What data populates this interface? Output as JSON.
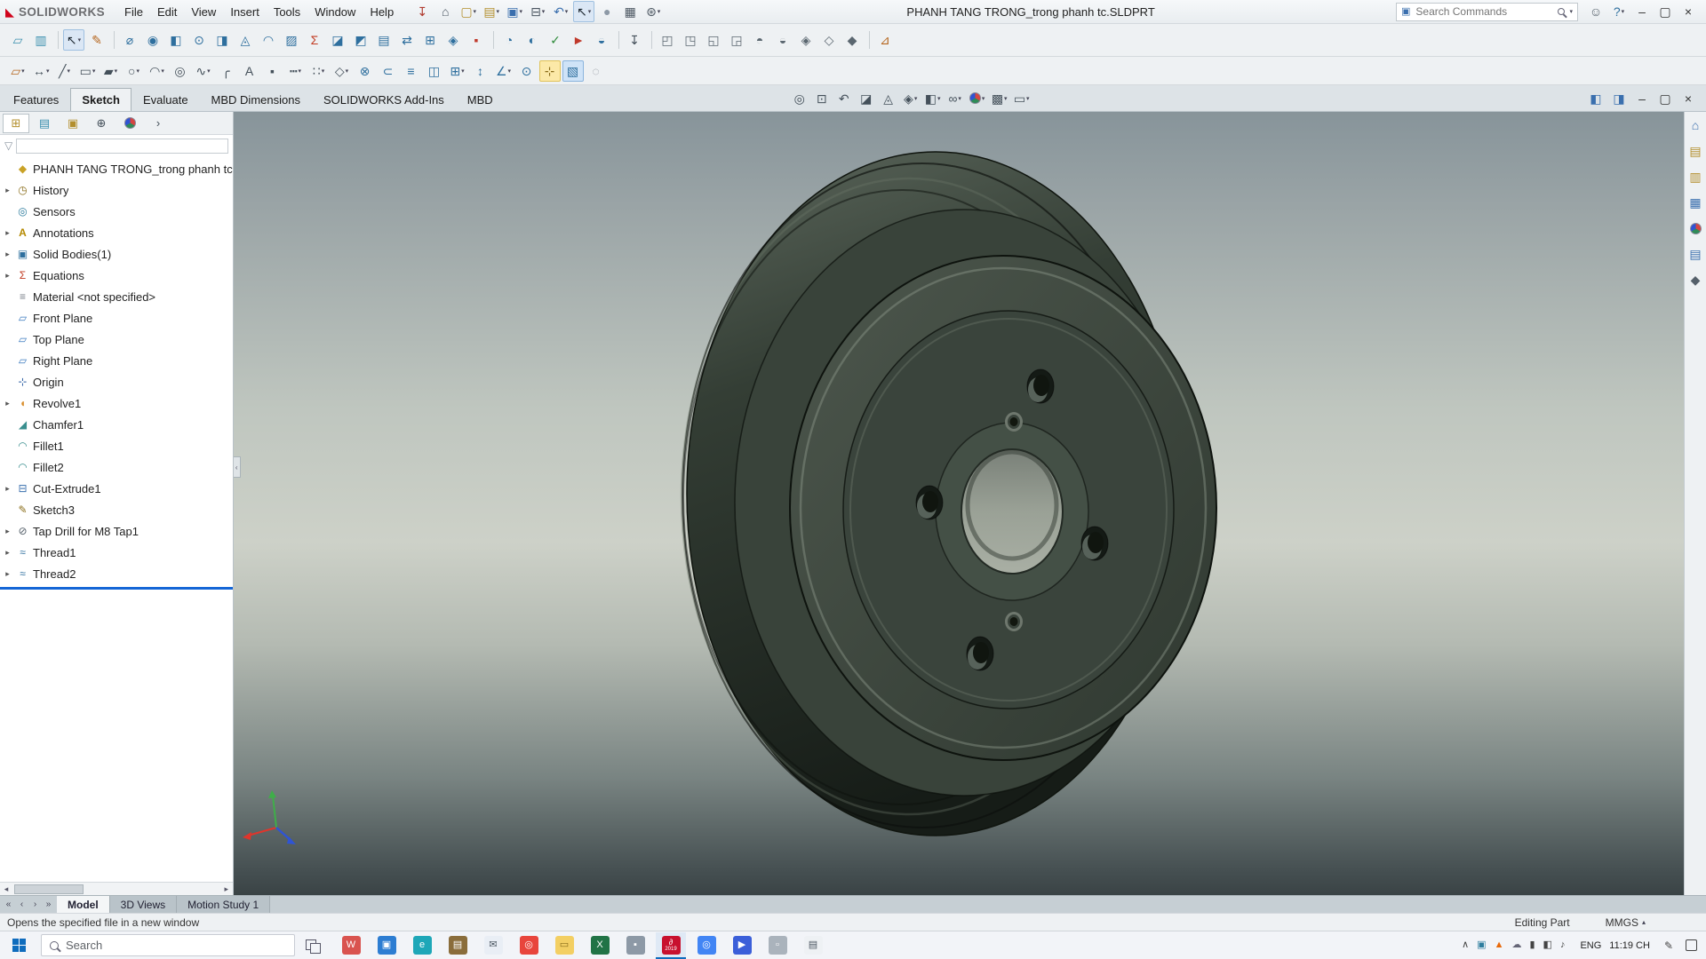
{
  "window": {
    "brand": "SOLIDWORKS",
    "title": "PHANH TANG TRONG_trong phanh tc.SLDPRT",
    "search_placeholder": "Search Commands",
    "menus": [
      "File",
      "Edit",
      "View",
      "Insert",
      "Tools",
      "Window",
      "Help"
    ],
    "quick_icons": [
      {
        "name": "pin-icon",
        "glyph": "↧",
        "color": "#b03a2e"
      },
      {
        "name": "home-icon",
        "glyph": "⌂",
        "color": "#4a5560"
      },
      {
        "name": "new-document-icon",
        "glyph": "▢",
        "color": "#b38f2d",
        "caret": true
      },
      {
        "name": "open-icon",
        "glyph": "▤",
        "color": "#b38f2d",
        "caret": true
      },
      {
        "name": "save-icon",
        "glyph": "▣",
        "color": "#3a6fae",
        "caret": true
      },
      {
        "name": "print-icon",
        "glyph": "⊟",
        "color": "#4a5560",
        "caret": true
      },
      {
        "name": "undo-icon",
        "glyph": "↶",
        "color": "#3a6fae",
        "caret": true
      },
      {
        "name": "select-cursor-icon",
        "glyph": "↖",
        "color": "#1f2a33",
        "caret": true,
        "pressed": true
      },
      {
        "name": "sphere-icon",
        "glyph": "●",
        "color": "#8d99a6"
      },
      {
        "name": "grid-options-icon",
        "glyph": "▦",
        "color": "#4a5560"
      },
      {
        "name": "options-gear-icon",
        "glyph": "⊛",
        "color": "#4a5560",
        "caret": true
      }
    ],
    "window_controls": [
      {
        "name": "user-account-icon",
        "glyph": "☺",
        "color": "#55606a"
      },
      {
        "name": "help-icon",
        "glyph": "?",
        "color": "#2e6f9e",
        "caret": true
      },
      {
        "name": "window-minimize-icon",
        "glyph": "–",
        "color": "#333333"
      },
      {
        "name": "window-restore-icon",
        "glyph": "▢",
        "color": "#333333"
      },
      {
        "name": "window-close-icon",
        "glyph": "×",
        "color": "#333333"
      }
    ]
  },
  "toolbar_row1": [
    {
      "name": "sheet-format-icon",
      "glyph": "▱",
      "color": "#3a8fae"
    },
    {
      "name": "design-table-icon",
      "glyph": "▥",
      "color": "#3a8fae"
    },
    {
      "sep": true
    },
    {
      "name": "select-tool-icon",
      "glyph": "↖",
      "color": "#1f2a33",
      "caret": true,
      "pressed": true
    },
    {
      "name": "sketch-pencil-icon",
      "glyph": "✎",
      "color": "#b5651d"
    },
    {
      "sep": true
    },
    {
      "name": "measure-icon",
      "glyph": "⌀",
      "color": "#2e6f9e"
    },
    {
      "name": "mass-properties-icon",
      "glyph": "◉",
      "color": "#2e6f9e"
    },
    {
      "name": "section-properties-icon",
      "glyph": "◧",
      "color": "#2e6f9e"
    },
    {
      "name": "sensor-icon",
      "glyph": "⊙",
      "color": "#2e6f9e"
    },
    {
      "name": "check-entity-icon",
      "glyph": "◨",
      "color": "#2e6f9e"
    },
    {
      "name": "geometry-analysis-icon",
      "glyph": "◬",
      "color": "#2e6f9e"
    },
    {
      "name": "curvature-icon",
      "glyph": "◠",
      "color": "#2e6f9e"
    },
    {
      "name": "zebra-stripes-icon",
      "glyph": "▨",
      "color": "#2e6f9e"
    },
    {
      "name": "equations-sigma-icon",
      "glyph": "Σ",
      "color": "#c23b22"
    },
    {
      "name": "draft-analysis-icon",
      "glyph": "◪",
      "color": "#2e6f9e"
    },
    {
      "name": "undercut-analysis-icon",
      "glyph": "◩",
      "color": "#2e6f9e"
    },
    {
      "name": "thickness-analysis-icon",
      "glyph": "▤",
      "color": "#2e6f9e"
    },
    {
      "name": "compare-documents-icon",
      "glyph": "⇄",
      "color": "#2e6f9e"
    },
    {
      "name": "symmetry-check-icon",
      "glyph": "⊞",
      "color": "#2e6f9e"
    },
    {
      "name": "deviation-analysis-icon",
      "glyph": "◈",
      "color": "#2e6f9e"
    },
    {
      "name": "stop-icon",
      "glyph": "▪",
      "color": "#c0392b"
    },
    {
      "sep": true
    },
    {
      "name": "performance-evaluation-icon",
      "glyph": "◔",
      "color": "#2e6f9e"
    },
    {
      "name": "import-diagnostics-icon",
      "glyph": "◐",
      "color": "#2e6f9e"
    },
    {
      "name": "geometry-check-icon",
      "glyph": "✓",
      "color": "#2e8b3a"
    },
    {
      "name": "error-flag-icon",
      "glyph": "►",
      "color": "#c0392b"
    },
    {
      "name": "design-checker-icon",
      "glyph": "◒",
      "color": "#2e6f9e"
    },
    {
      "sep": true
    },
    {
      "name": "mate-anchor-icon",
      "glyph": "↧",
      "color": "#44505a"
    },
    {
      "sep": true
    },
    {
      "name": "view-front-icon",
      "glyph": "◰",
      "color": "#5b6770"
    },
    {
      "name": "view-back-icon",
      "glyph": "◳",
      "color": "#5b6770"
    },
    {
      "name": "view-left-icon",
      "glyph": "◱",
      "color": "#5b6770"
    },
    {
      "name": "view-right-icon",
      "glyph": "◲",
      "color": "#5b6770"
    },
    {
      "name": "view-top-icon",
      "glyph": "◓",
      "color": "#5b6770"
    },
    {
      "name": "view-bottom-icon",
      "glyph": "◒",
      "color": "#5b6770"
    },
    {
      "name": "view-isometric-icon",
      "glyph": "◈",
      "color": "#5b6770"
    },
    {
      "name": "view-dimetric-icon",
      "glyph": "◇",
      "color": "#5b6770"
    },
    {
      "name": "view-trimetric-icon",
      "glyph": "◆",
      "color": "#5b6770"
    },
    {
      "sep": true
    },
    {
      "name": "tape-measure-icon",
      "glyph": "⊿",
      "color": "#b5651d"
    }
  ],
  "toolbar_row2": [
    {
      "name": "sketch-icon",
      "glyph": "▱",
      "color": "#b5651d",
      "caret": true
    },
    {
      "name": "smart-dimension-icon",
      "glyph": "↔",
      "color": "#44505a",
      "caret": true
    },
    {
      "name": "line-icon",
      "glyph": "╱",
      "color": "#44505a",
      "caret": true
    },
    {
      "name": "rectangle-icon",
      "glyph": "▭",
      "color": "#44505a",
      "caret": true
    },
    {
      "name": "slot-icon",
      "glyph": "▰",
      "color": "#44505a",
      "caret": true
    },
    {
      "name": "circle-icon",
      "glyph": "○",
      "color": "#44505a",
      "caret": true
    },
    {
      "name": "arc-icon",
      "glyph": "◠",
      "color": "#44505a",
      "caret": true
    },
    {
      "name": "ellipse-icon",
      "glyph": "◎",
      "color": "#44505a"
    },
    {
      "name": "spline-icon",
      "glyph": "∿",
      "color": "#44505a",
      "caret": true
    },
    {
      "name": "conic-icon",
      "glyph": "╭",
      "color": "#44505a"
    },
    {
      "name": "text-icon",
      "glyph": "A",
      "color": "#44505a"
    },
    {
      "name": "point-icon",
      "glyph": "▪",
      "color": "#44505a"
    },
    {
      "name": "centerline-icon",
      "glyph": "┅",
      "color": "#44505a",
      "caret": true
    },
    {
      "name": "pattern-icon",
      "glyph": "∷",
      "color": "#44505a",
      "caret": true
    },
    {
      "name": "polygon-icon",
      "glyph": "◇",
      "color": "#44505a",
      "caret": true
    },
    {
      "name": "trim-entities-icon",
      "glyph": "⊗",
      "color": "#2e6f9e"
    },
    {
      "name": "convert-entities-icon",
      "glyph": "⊂",
      "color": "#2e6f9e"
    },
    {
      "name": "offset-entities-icon",
      "glyph": "≡",
      "color": "#2e6f9e"
    },
    {
      "name": "mirror-entities-icon",
      "glyph": "◫",
      "color": "#2e6f9e"
    },
    {
      "name": "linear-sketch-pattern-icon",
      "glyph": "⊞",
      "color": "#2e6f9e",
      "caret": true
    },
    {
      "name": "move-entities-icon",
      "glyph": "↕",
      "color": "#2e6f9e"
    },
    {
      "name": "display-relations-icon",
      "glyph": "∠",
      "color": "#2e6f9e",
      "caret": true
    },
    {
      "name": "repair-sketch-icon",
      "glyph": "⊙",
      "color": "#2e6f9e"
    },
    {
      "name": "quick-snaps-icon",
      "glyph": "⊹",
      "color": "#8a6d1a",
      "hl": "yellow"
    },
    {
      "name": "sketch-picture-icon",
      "glyph": "▧",
      "color": "#2e6f9e",
      "hl": "blue"
    },
    {
      "name": "sketch-settings-icon",
      "glyph": "◌",
      "color": "#8a8f98"
    }
  ],
  "command_tabs": [
    {
      "label": "Features"
    },
    {
      "label": "Sketch",
      "active": true
    },
    {
      "label": "Evaluate"
    },
    {
      "label": "MBD Dimensions"
    },
    {
      "label": "SOLIDWORKS Add-Ins"
    },
    {
      "label": "MBD"
    }
  ],
  "headsup_icons": [
    {
      "name": "zoom-fit-icon",
      "glyph": "◎",
      "color": "#44505a"
    },
    {
      "name": "zoom-area-icon",
      "glyph": "⊡",
      "color": "#44505a"
    },
    {
      "name": "previous-view-icon",
      "glyph": "↶",
      "color": "#44505a"
    },
    {
      "name": "section-view-icon",
      "glyph": "◪",
      "color": "#44505a"
    },
    {
      "name": "dynamic-annotation-icon",
      "glyph": "◬",
      "color": "#44505a"
    },
    {
      "name": "view-orientation-icon",
      "glyph": "◈",
      "color": "#44505a",
      "caret": true
    },
    {
      "name": "display-style-icon",
      "glyph": "◧",
      "color": "#44505a",
      "caret": true
    },
    {
      "name": "hide-show-items-icon",
      "glyph": "∞",
      "color": "#44505a",
      "caret": true
    },
    {
      "name": "edit-appearance-icon",
      "ball": true,
      "caret": true
    },
    {
      "name": "apply-scene-icon",
      "glyph": "▩",
      "color": "#44505a",
      "caret": true
    },
    {
      "name": "view-settings-icon",
      "glyph": "▭",
      "color": "#44505a",
      "caret": true
    }
  ],
  "doc_window_controls": [
    {
      "name": "featuremanager-pane-icon",
      "glyph": "◧",
      "color": "#3a6fae"
    },
    {
      "name": "display-pane-icon",
      "glyph": "◨",
      "color": "#3a6fae"
    },
    {
      "name": "doc-minimize-icon",
      "glyph": "–",
      "color": "#333333"
    },
    {
      "name": "doc-restore-icon",
      "glyph": "▢",
      "color": "#333333"
    },
    {
      "name": "doc-close-icon",
      "glyph": "×",
      "color": "#333333"
    }
  ],
  "feature_panel": {
    "tabs": [
      {
        "name": "featuremanager-tab-icon",
        "glyph": "⊞",
        "color": "#b38f2d",
        "active": true
      },
      {
        "name": "propertymanager-tab-icon",
        "glyph": "▤",
        "color": "#3a8fae"
      },
      {
        "name": "configurationmanager-tab-icon",
        "glyph": "▣",
        "color": "#b38f2d"
      },
      {
        "name": "dimxpertmanager-tab-icon",
        "glyph": "⊕",
        "color": "#44505a"
      },
      {
        "name": "displaymanager-tab-icon",
        "ball": true
      },
      {
        "name": "panel-tab-overflow-icon",
        "glyph": "›",
        "color": "#44505a"
      }
    ],
    "filter_placeholder": "",
    "root": {
      "label": "PHANH TANG TRONG_trong phanh tc",
      "glyph": "◆",
      "color": "#c9a227"
    },
    "items": [
      {
        "label": "History",
        "icon": "history",
        "glyph": "◷",
        "color": "#8a6d1a",
        "arrow": true
      },
      {
        "label": "Sensors",
        "icon": "sensors",
        "glyph": "◎",
        "color": "#2e7d9e",
        "arrow": false
      },
      {
        "label": "Annotations",
        "icon": "annotations",
        "glyph": "A",
        "color": "#b58900",
        "arrow": true,
        "bold": true
      },
      {
        "label": "Solid Bodies(1)",
        "icon": "solid-bodies",
        "glyph": "▣",
        "color": "#2e6f9e",
        "arrow": true
      },
      {
        "label": "Equations",
        "icon": "equations",
        "glyph": "Σ",
        "color": "#c23b22",
        "arrow": true
      },
      {
        "label": "Material <not specified>",
        "icon": "material",
        "glyph": "≡",
        "color": "#7a828a",
        "arrow": false
      },
      {
        "label": "Front Plane",
        "icon": "plane",
        "glyph": "▱",
        "color": "#3a7abf",
        "arrow": false
      },
      {
        "label": "Top Plane",
        "icon": "plane",
        "glyph": "▱",
        "color": "#3a7abf",
        "arrow": false
      },
      {
        "label": "Right Plane",
        "icon": "plane",
        "glyph": "▱",
        "color": "#3a7abf",
        "arrow": false
      },
      {
        "label": "Origin",
        "icon": "origin",
        "glyph": "⊹",
        "color": "#2e5fa3",
        "arrow": false
      },
      {
        "label": "Revolve1",
        "icon": "revolve",
        "glyph": "◖",
        "color": "#d98e2b",
        "arrow": true
      },
      {
        "label": "Chamfer1",
        "icon": "chamfer",
        "glyph": "◢",
        "color": "#3a8f8f",
        "arrow": false
      },
      {
        "label": "Fillet1",
        "icon": "fillet",
        "glyph": "◠",
        "color": "#3a8f8f",
        "arrow": false
      },
      {
        "label": "Fillet2",
        "icon": "fillet",
        "glyph": "◠",
        "color": "#3a8f8f",
        "arrow": false
      },
      {
        "label": "Cut-Extrude1",
        "icon": "cut-extrude",
        "glyph": "⊟",
        "color": "#3a6fae",
        "arrow": true
      },
      {
        "label": "Sketch3",
        "icon": "sketch",
        "glyph": "✎",
        "color": "#8a6d1a",
        "arrow": false
      },
      {
        "label": "Tap Drill for M8 Tap1",
        "icon": "tap-drill",
        "glyph": "⊘",
        "color": "#55606a",
        "arrow": true
      },
      {
        "label": "Thread1",
        "icon": "thread",
        "glyph": "≈",
        "color": "#2e6f9e",
        "arrow": true
      },
      {
        "label": "Thread2",
        "icon": "thread",
        "glyph": "≈",
        "color": "#2e6f9e",
        "arrow": true
      }
    ]
  },
  "task_pane_icons": [
    {
      "name": "task-pane-home-icon",
      "glyph": "⌂",
      "color": "#3a6fae"
    },
    {
      "name": "design-library-icon",
      "glyph": "▤",
      "color": "#b38f2d"
    },
    {
      "name": "file-explorer-icon",
      "glyph": "▥",
      "color": "#b38f2d"
    },
    {
      "name": "view-palette-icon",
      "glyph": "▦",
      "color": "#3a6fae"
    },
    {
      "name": "appearances-icon",
      "ball": true
    },
    {
      "name": "custom-properties-icon",
      "glyph": "▤",
      "color": "#3a6fae"
    },
    {
      "name": "forum-icon",
      "glyph": "◆",
      "color": "#55606a"
    }
  ],
  "doc_tabs": {
    "nav": [
      {
        "name": "first-model-tab-icon",
        "glyph": "«"
      },
      {
        "name": "prev-model-tab-icon",
        "glyph": "‹"
      },
      {
        "name": "next-model-tab-icon",
        "glyph": "›"
      },
      {
        "name": "last-model-tab-icon",
        "glyph": "»"
      }
    ],
    "tabs": [
      {
        "label": "Model",
        "active": true
      },
      {
        "label": "3D Views"
      },
      {
        "label": "Motion Study 1"
      }
    ]
  },
  "status_bar": {
    "message": "Opens the specified file in a new window",
    "mode": "Editing Part",
    "units": "MMGS"
  },
  "taskbar": {
    "search_placeholder": "Search",
    "apps": [
      {
        "name": "taskbar-wps-icon",
        "bg": "#d9534f",
        "glyph": "W",
        "fg": "#ffffff"
      },
      {
        "name": "taskbar-photos-icon",
        "bg": "#2d7dd2",
        "glyph": "▣",
        "fg": "#ffffff"
      },
      {
        "name": "taskbar-edge-icon",
        "bg": "#1ea7b8",
        "glyph": "e",
        "fg": "#ffffff"
      },
      {
        "name": "taskbar-notes-icon",
        "bg": "#8a6d3b",
        "glyph": "▤",
        "fg": "#ffffff"
      },
      {
        "name": "taskbar-mail-icon",
        "bg": "#e9eef5",
        "glyph": "✉",
        "fg": "#4a5560"
      },
      {
        "name": "taskbar-chrome-icon",
        "bg": "#e8453c",
        "glyph": "◎",
        "fg": "#ffffff"
      },
      {
        "name": "taskbar-folder-icon",
        "bg": "#f3cf63",
        "glyph": "▭",
        "fg": "#8a6d1a"
      },
      {
        "name": "taskbar-excel-icon",
        "bg": "#217346",
        "glyph": "X",
        "fg": "#ffffff"
      },
      {
        "name": "taskbar-app-icon",
        "bg": "#8d99a6",
        "glyph": "▪",
        "fg": "#ffffff"
      },
      {
        "name": "taskbar-solidworks-icon",
        "bg": "#c8102e",
        "glyph": "∂",
        "fg": "#ffffff",
        "active": true,
        "badge": "2019"
      },
      {
        "name": "taskbar-chrome2-icon",
        "bg": "#4285f4",
        "glyph": "◎",
        "fg": "#ffffff"
      },
      {
        "name": "taskbar-player-icon",
        "bg": "#3b5fd9",
        "glyph": "▶",
        "fg": "#ffffff"
      },
      {
        "name": "taskbar-app2-icon",
        "bg": "#aab3bc",
        "glyph": "▫",
        "fg": "#ffffff"
      },
      {
        "name": "taskbar-notepad-icon",
        "bg": "#eef1f4",
        "glyph": "▤",
        "fg": "#4a5560"
      }
    ],
    "tray": [
      {
        "name": "tray-expand-icon",
        "glyph": "∧",
        "color": "#444444"
      },
      {
        "name": "tray-app-icon",
        "glyph": "▣",
        "color": "#2e7d9e"
      },
      {
        "name": "tray-vlc-icon",
        "glyph": "▲",
        "color": "#e8690a"
      },
      {
        "name": "tray-onedrive-icon",
        "glyph": "☁",
        "color": "#666677"
      },
      {
        "name": "tray-battery-icon",
        "glyph": "▮",
        "color": "#444444"
      },
      {
        "name": "tray-network-icon",
        "glyph": "◧",
        "color": "#444444"
      },
      {
        "name": "tray-volume-icon",
        "glyph": "♪",
        "color": "#444444"
      }
    ],
    "language": "ENG",
    "time": "11:19 CH"
  },
  "viewport": {
    "model_color": "#3e4a40",
    "triad": {
      "x_color": "#e0352b",
      "y_color": "#3fae49",
      "z_color": "#2f54d4"
    }
  }
}
